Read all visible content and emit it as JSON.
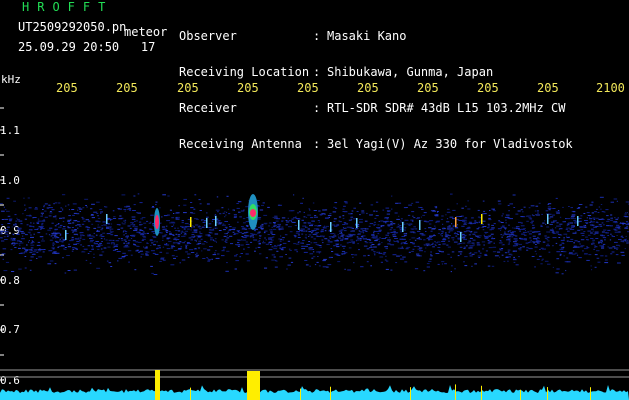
{
  "app": {
    "title": "HROFFT"
  },
  "info": {
    "filename": "UT2509292050.pn",
    "mode": "meteor",
    "datetime": "25.09.29 20:50",
    "counter": "17"
  },
  "station": {
    "rows": [
      {
        "label": "Observer",
        "sep": ":",
        "value": "Masaki Kano"
      },
      {
        "label": "Receiving Location",
        "sep": ":",
        "value": "Shibukawa, Gunma, Japan"
      },
      {
        "label": "Receiver",
        "sep": ":",
        "value": "RTL-SDR SDR# 43dB L15 103.2MHz CW"
      },
      {
        "label": "Receiving Antenna",
        "sep": ":",
        "value": "3el Yagi(V) Az 330 for Vladivostok"
      }
    ]
  },
  "axis": {
    "y_unit": "kHz",
    "y_ticks": [
      "1.1",
      "1.0",
      "0.9",
      "0.8",
      "0.7",
      "0.6"
    ],
    "x_ticks": [
      "205",
      "205",
      "205",
      "205",
      "205",
      "205",
      "205",
      "205",
      "205",
      "2100"
    ]
  },
  "colors": {
    "background": "#000000",
    "header_green": "#22dd55",
    "tick_yellow": "#f2e85a",
    "signal_blue": "#1a2fb0",
    "echo_red": "#ff2a6a",
    "profile_cyan": "#28d8ff",
    "profile_yellow": "#ffee00"
  }
}
